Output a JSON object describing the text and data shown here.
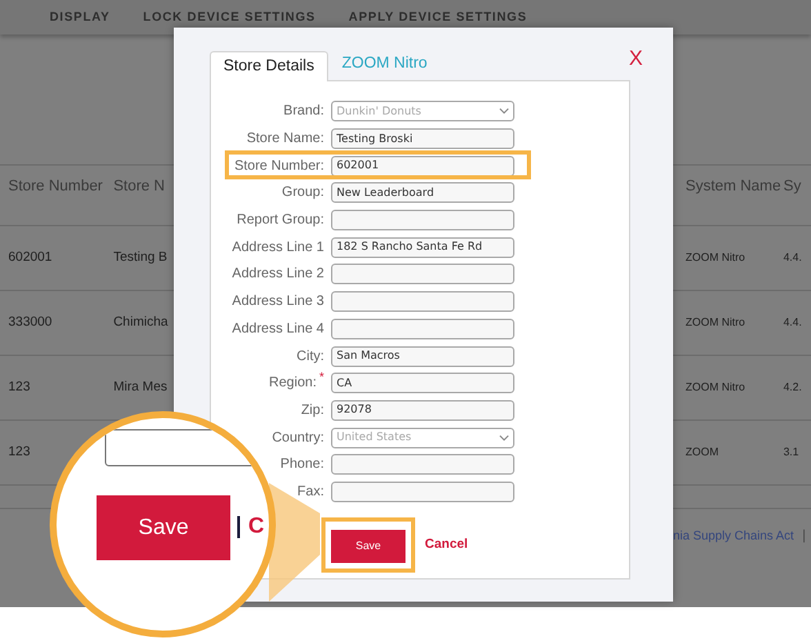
{
  "nav": [
    {
      "label": "DISPLAY"
    },
    {
      "label": "LOCK DEVICE SETTINGS"
    },
    {
      "label": "APPLY DEVICE SETTINGS"
    }
  ],
  "table": {
    "columns": [
      "Store Number",
      "Store N",
      "System Name",
      "Sy"
    ],
    "rows": [
      {
        "store_number": "602001",
        "store_name": "Testing B",
        "system_name": "ZOOM Nitro",
        "column_4": "4.4."
      },
      {
        "store_number": "333000",
        "store_name": "Chimicha",
        "system_name": "ZOOM Nitro",
        "column_4": "4.4."
      },
      {
        "store_number": "123",
        "store_name": "Mira Mes",
        "system_name": "ZOOM Nitro",
        "column_4": "4.2."
      },
      {
        "store_number": "123",
        "system_name": "ZOOM",
        "column_4": "3.1"
      }
    ]
  },
  "footer": {
    "link": "nia Supply Chains Act",
    "separator": "|"
  },
  "modal": {
    "tabs": [
      {
        "label": "Store Details",
        "selected": true
      },
      {
        "label": "ZOOM Nitro",
        "selected": false
      }
    ],
    "close": "X",
    "fields": [
      {
        "label": "Brand:",
        "kind": "select",
        "value": "Dunkin' Donuts",
        "disabled": true
      },
      {
        "label": "Store Name:",
        "kind": "text",
        "value": "Testing Broski"
      },
      {
        "label": "Store Number:",
        "kind": "text",
        "value": "602001",
        "highlighted": true
      },
      {
        "label": "Group:",
        "kind": "text",
        "value": "New Leaderboard"
      },
      {
        "label": "Report Group:",
        "kind": "text"
      },
      {
        "label": "Address Line 1",
        "kind": "text",
        "value": "182 S Rancho Santa Fe Rd"
      },
      {
        "label": "Address Line 2",
        "kind": "text"
      },
      {
        "label": "Address Line 3",
        "kind": "text"
      },
      {
        "label": "Address Line 4",
        "kind": "text"
      },
      {
        "label": "City:",
        "kind": "text",
        "value": "San Macros"
      },
      {
        "label": "Region:",
        "kind": "text",
        "value": "CA",
        "required": true,
        "required_mark": "*"
      },
      {
        "label": "Zip:",
        "kind": "text",
        "value": "92078"
      },
      {
        "label": "Country:",
        "kind": "select",
        "value": "United States",
        "disabled": true
      },
      {
        "label": "Phone:",
        "kind": "text"
      },
      {
        "label": "Fax:",
        "kind": "text"
      }
    ],
    "save": {
      "label": "Save",
      "highlighted": true
    },
    "cancel": "Cancel"
  },
  "magnifier": {
    "save": "Save",
    "cancel_partial": "C"
  }
}
